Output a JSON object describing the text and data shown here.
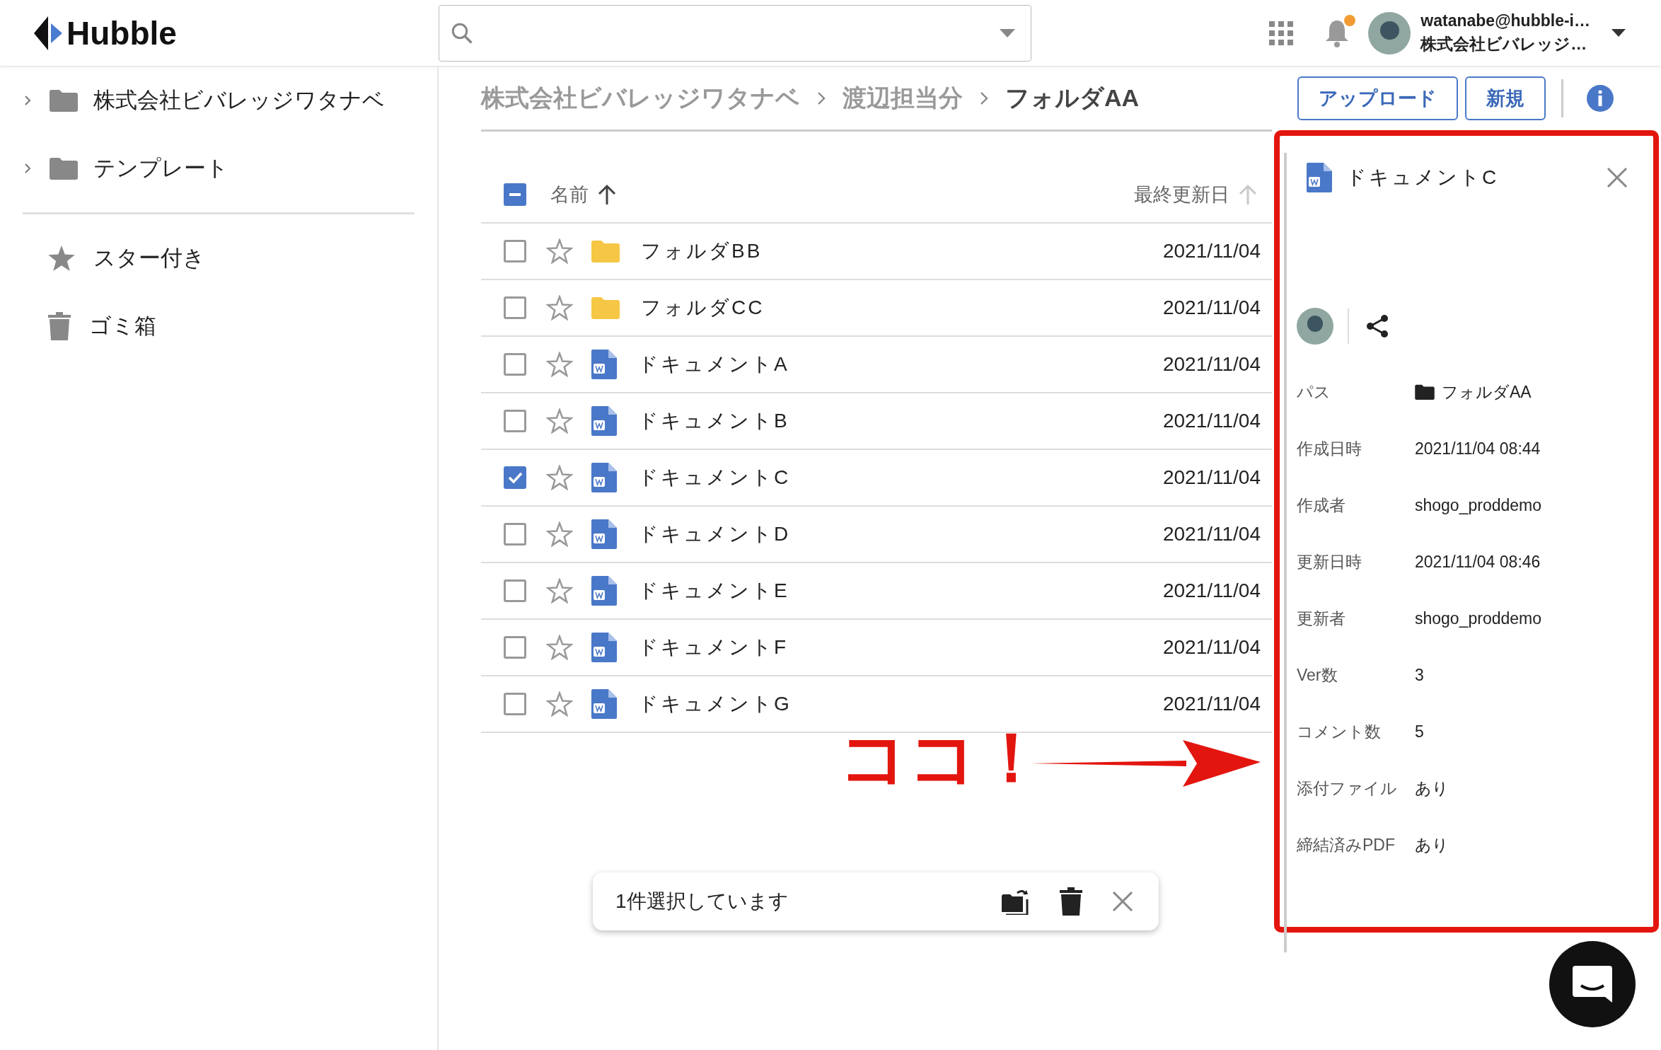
{
  "header": {
    "logo": "Hubble",
    "notification_unread": true,
    "user": {
      "email": "watanabe@hubble-i…",
      "company": "株式会社ビバレッジ…"
    }
  },
  "sidebar": {
    "folders": [
      {
        "label": "株式会社ビバレッジワタナベ",
        "expanded": false
      },
      {
        "label": "テンプレート",
        "expanded": false
      }
    ],
    "items": [
      {
        "label": "スター付き",
        "kind": "star"
      },
      {
        "label": "ゴミ箱",
        "kind": "trash"
      }
    ]
  },
  "breadcrumb": [
    "株式会社ビバレッジワタナベ",
    "渡辺担当分",
    "フォルダAA"
  ],
  "toolbar_buttons": [
    "アップロード",
    "新規"
  ],
  "table": {
    "select_all_indeterminate": true,
    "columns": [
      {
        "label": "名前",
        "sort_active": true
      },
      {
        "label": "最終更新日",
        "sort_active": false
      }
    ],
    "rows": [
      {
        "name": "フォルダBB",
        "kind": "folder",
        "date": "2021/11/04",
        "checked": false,
        "starred": false
      },
      {
        "name": "フォルダCC",
        "kind": "folder",
        "date": "2021/11/04",
        "checked": false,
        "starred": false
      },
      {
        "name": "ドキュメントA",
        "kind": "document",
        "date": "2021/11/04",
        "checked": false,
        "starred": false
      },
      {
        "name": "ドキュメントB",
        "kind": "document",
        "date": "2021/11/04",
        "checked": false,
        "starred": false
      },
      {
        "name": "ドキュメントC",
        "kind": "document",
        "date": "2021/11/04",
        "checked": true,
        "starred": false
      },
      {
        "name": "ドキュメントD",
        "kind": "document",
        "date": "2021/11/04",
        "checked": false,
        "starred": false
      },
      {
        "name": "ドキュメントE",
        "kind": "document",
        "date": "2021/11/04",
        "checked": false,
        "starred": false
      },
      {
        "name": "ドキュメントF",
        "kind": "document",
        "date": "2021/11/04",
        "checked": false,
        "starred": false
      },
      {
        "name": "ドキュメントG",
        "kind": "document",
        "date": "2021/11/04",
        "checked": false,
        "starred": false
      }
    ]
  },
  "detail_panel": {
    "title": "ドキュメントC",
    "fields": [
      {
        "label": "パス",
        "value": "フォルダAA",
        "kind": "path"
      },
      {
        "label": "作成日時",
        "value": "2021/11/04 08:44",
        "kind": "text"
      },
      {
        "label": "作成者",
        "value": "shogo_proddemo",
        "kind": "text"
      },
      {
        "label": "更新日時",
        "value": "2021/11/04 08:46",
        "kind": "text"
      },
      {
        "label": "更新者",
        "value": "shogo_proddemo",
        "kind": "text"
      },
      {
        "label": "Ver数",
        "value": "3",
        "kind": "text"
      },
      {
        "label": "コメント数",
        "value": "5",
        "kind": "text"
      },
      {
        "label": "添付ファイル",
        "value": "あり",
        "kind": "text"
      },
      {
        "label": "締結済みPDF",
        "value": "あり",
        "kind": "text"
      }
    ]
  },
  "selection_bar": {
    "text": "1件選択しています"
  },
  "annotation": {
    "text": "ココ！"
  }
}
